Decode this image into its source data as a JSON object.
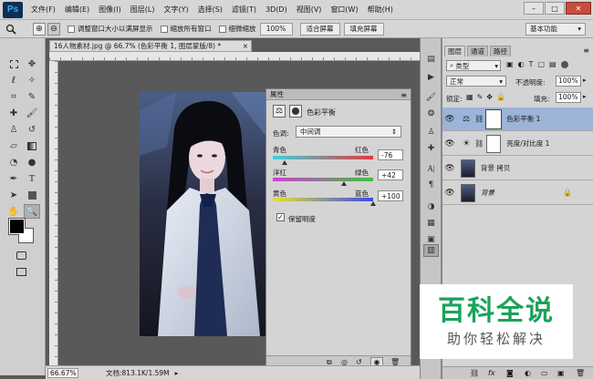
{
  "app": {
    "logo": "Ps"
  },
  "menus": [
    "文件(F)",
    "编辑(E)",
    "图像(I)",
    "图层(L)",
    "文字(Y)",
    "选择(S)",
    "滤镜(T)",
    "3D(D)",
    "视图(V)",
    "窗口(W)",
    "帮助(H)"
  ],
  "window_controls": {
    "minimize": "–",
    "maximize": "□",
    "close": "✕"
  },
  "options": {
    "check1": "调整窗口大小以满屏显示",
    "check2": "缩放所有窗口",
    "check3": "细微缩放",
    "zoom_btn": "100%",
    "fit_btn": "适合屏幕",
    "fill_btn": "填充屏幕",
    "workspace": "基本功能"
  },
  "document": {
    "tab": "16人物素材.jpg @ 66.7% (色彩平衡 1, 图层蒙版/8) *",
    "tab_close": "×",
    "zoom": "66.67%",
    "file_info": "文档:813.1K/1.59M"
  },
  "properties": {
    "title": "属性",
    "adjust_name": "色彩平衡",
    "tone_label": "色调:",
    "tone_value": "中间调",
    "sliders": [
      {
        "left": "青色",
        "right": "红色",
        "value": "-76",
        "pos": 0.12
      },
      {
        "left": "洋红",
        "right": "绿色",
        "value": "+42",
        "pos": 0.71
      },
      {
        "left": "黄色",
        "right": "蓝色",
        "value": "+100",
        "pos": 1.0
      }
    ],
    "preserve": "保留明度"
  },
  "layers_panel": {
    "tabs": [
      "图层",
      "通道",
      "路径"
    ],
    "filter": "类型",
    "blend": "正常",
    "opacity_label": "不透明度:",
    "opacity": "100%",
    "lock_label": "锁定:",
    "fill_label": "填充:",
    "fill": "100%",
    "layers": [
      {
        "name": "色彩平衡 1",
        "selected": true
      },
      {
        "name": "亮度/对比度 1",
        "selected": false
      },
      {
        "name": "背景 拷贝",
        "selected": false
      },
      {
        "name": "背景",
        "selected": false
      }
    ]
  },
  "watermark": {
    "title": "百科全说",
    "subtitle": "助你轻松解决"
  },
  "colors": {
    "accent": "#9bb4d8",
    "watermark": "#1aa35a"
  }
}
